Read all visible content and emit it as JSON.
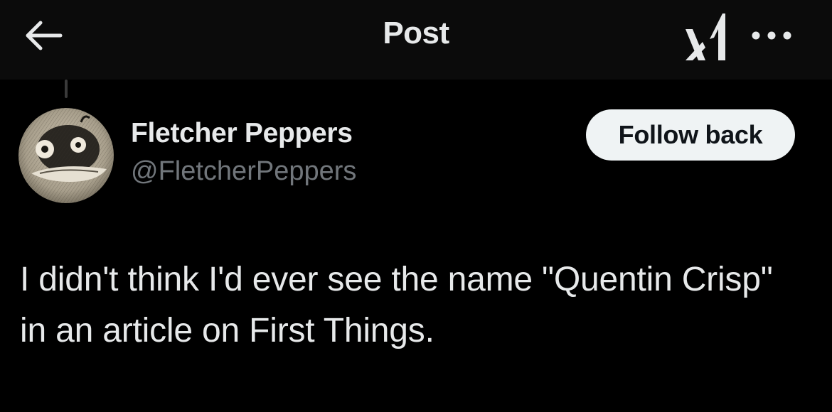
{
  "header": {
    "title": "Post",
    "back_icon": "arrow-left-icon",
    "grok_icon": "grok-icon",
    "more_icon": "more-horizontal-icon"
  },
  "post": {
    "author": {
      "display_name": "Fletcher Peppers",
      "handle": "@FletcherPeppers"
    },
    "follow_button_label": "Follow back",
    "text": "I didn't think I'd ever see the name \"Quentin Crisp\" in an article on First Things."
  },
  "colors": {
    "background": "#000000",
    "header_background": "#0b0b0b",
    "primary_text": "#e7e9ea",
    "secondary_text": "#71767b",
    "button_background": "#eff3f4",
    "button_text": "#0f1419"
  }
}
